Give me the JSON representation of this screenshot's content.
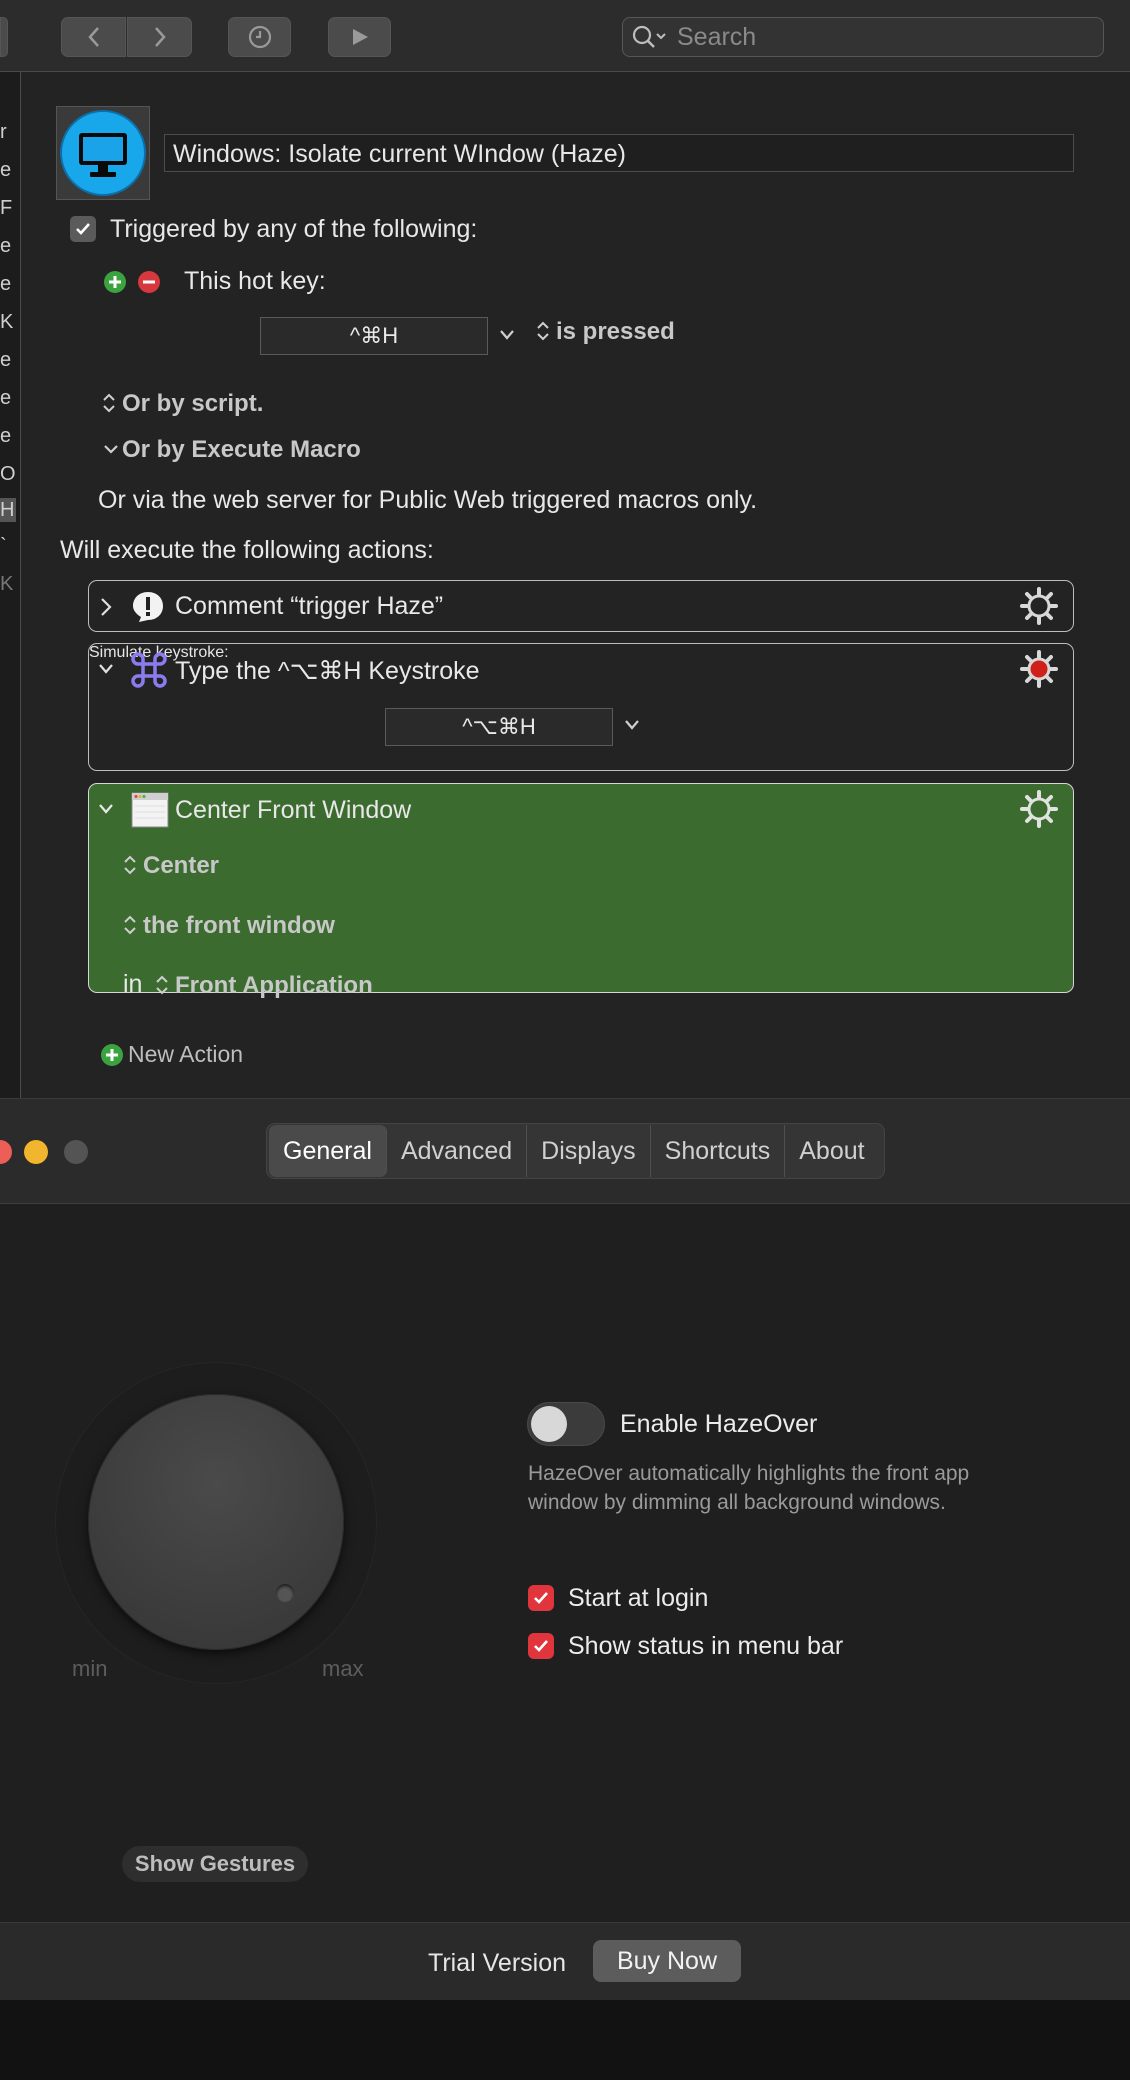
{
  "toolbar": {
    "search_placeholder": "Search"
  },
  "left_strip": [
    "r",
    "e",
    "F",
    "e",
    "e",
    "K",
    "e",
    "e",
    "e",
    "O",
    "H",
    "`",
    "K"
  ],
  "macro": {
    "name": "Windows: Isolate current WIndow (Haze)",
    "triggered_label": "Triggered by any of the following:",
    "hotkey_label": "This hot key:",
    "hotkey_value": "^⌘H",
    "hotkey_state": "is pressed",
    "or_script": "Or by script.",
    "or_execute": "Or by Execute Macro",
    "web_server": "Or via the web server for Public Web triggered macros only.",
    "will_execute": "Will execute the following actions:",
    "actions": [
      {
        "title": "Comment “trigger Haze”"
      },
      {
        "title": "Type the ^⌥⌘H Keystroke",
        "field_label": "Simulate keystroke:",
        "field_value": "^⌥⌘H"
      },
      {
        "title": "Center Front Window",
        "opt1": "Center",
        "opt2": "the front window",
        "in_label": "in",
        "opt3": "Front Application"
      }
    ],
    "new_action": "New Action",
    "colors": {
      "green_block": "#3b6b2f",
      "accent_blue": "#1aa3e8"
    }
  },
  "hazeover": {
    "tabs": [
      "General",
      "Advanced",
      "Displays",
      "Shortcuts",
      "About"
    ],
    "active_tab": "General",
    "knob_min": "min",
    "knob_max": "max",
    "enable_label": "Enable HazeOver",
    "enabled": false,
    "description_line1": "HazeOver automatically highlights the front app",
    "description_line2": "window by dimming all background windows.",
    "start_at_login": "Start at login",
    "show_status": "Show status in menu bar",
    "show_gestures": "Show Gestures",
    "trial": "Trial Version",
    "buy_now": "Buy Now"
  }
}
